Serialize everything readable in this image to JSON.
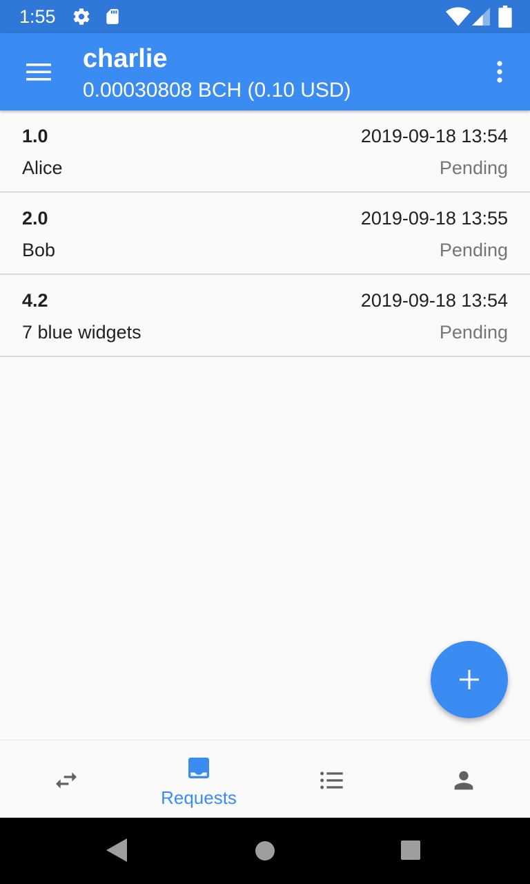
{
  "status_bar": {
    "time": "1:55",
    "icons": [
      "gear-icon",
      "sd-card-icon",
      "wifi-icon",
      "cell-signal-icon",
      "battery-icon"
    ]
  },
  "app_bar": {
    "title": "charlie",
    "balance": "0.00030808 BCH (0.10 USD)",
    "color": "#3a8cf3"
  },
  "requests": [
    {
      "amount": "1.0",
      "date": "2019-09-18 13:54",
      "description": "Alice",
      "status": "Pending"
    },
    {
      "amount": "2.0",
      "date": "2019-09-18 13:55",
      "description": "Bob",
      "status": "Pending"
    },
    {
      "amount": "4.2",
      "date": "2019-09-18 13:54",
      "description": "7 blue widgets",
      "status": "Pending"
    }
  ],
  "fab": {
    "icon": "plus-icon"
  },
  "bottom_nav": {
    "items": [
      {
        "icon": "transfer-arrows-icon",
        "label": ""
      },
      {
        "icon": "inbox-download-icon",
        "label": "Requests",
        "active": true
      },
      {
        "icon": "list-icon",
        "label": ""
      },
      {
        "icon": "person-icon",
        "label": ""
      }
    ],
    "active_color": "#3a8cf3"
  }
}
